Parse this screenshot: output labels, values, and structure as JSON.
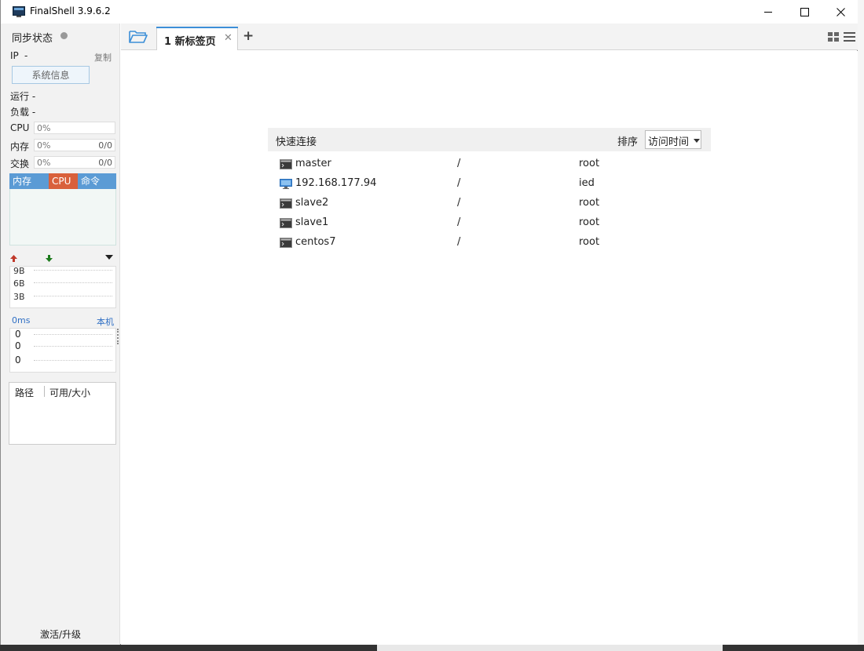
{
  "window": {
    "title": "FinalShell 3.9.6.2"
  },
  "sidebar": {
    "sync_label": "同步状态",
    "ip_label": "IP",
    "ip_value": "-",
    "copy_label": "复制",
    "sysinfo_button": "系统信息",
    "uptime_label": "运行 -",
    "load_label": "负载 -",
    "cpu": {
      "label": "CPU",
      "value": "0%"
    },
    "mem": {
      "label": "内存",
      "value": "0%",
      "ratio": "0/0"
    },
    "swap": {
      "label": "交换",
      "value": "0%",
      "ratio": "0/0"
    },
    "process_tabs": [
      "内存",
      "CPU",
      "命令"
    ],
    "net_ticks": [
      "9B",
      "6B",
      "3B"
    ],
    "ping": {
      "latency": "0ms",
      "host": "本机",
      "values": [
        "0",
        "0",
        "0"
      ]
    },
    "disk": {
      "path_header": "路径",
      "size_header": "可用/大小"
    },
    "activate_label": "激活/升级"
  },
  "tabs": [
    {
      "label": "1 新标签页"
    }
  ],
  "main": {
    "quick_connect_title": "快速连接",
    "sort_label": "排序",
    "sort_value": "访问时间",
    "connections": [
      {
        "name": "master",
        "path": "/",
        "user": "root",
        "icon": "terminal-icon"
      },
      {
        "name": "192.168.177.94",
        "path": "/",
        "user": "ied",
        "icon": "desktop-icon"
      },
      {
        "name": "slave2",
        "path": "/",
        "user": "root",
        "icon": "terminal-icon"
      },
      {
        "name": "slave1",
        "path": "/",
        "user": "root",
        "icon": "terminal-icon"
      },
      {
        "name": "centos7",
        "path": "/",
        "user": "root",
        "icon": "terminal-icon"
      }
    ]
  },
  "colors": {
    "accent": "#5b9bd5",
    "cpu_tab": "#d9603b",
    "tab_active_border": "#3c8fd8",
    "upload_arrow": "#c0392b",
    "download_arrow": "#1e7b1e"
  }
}
